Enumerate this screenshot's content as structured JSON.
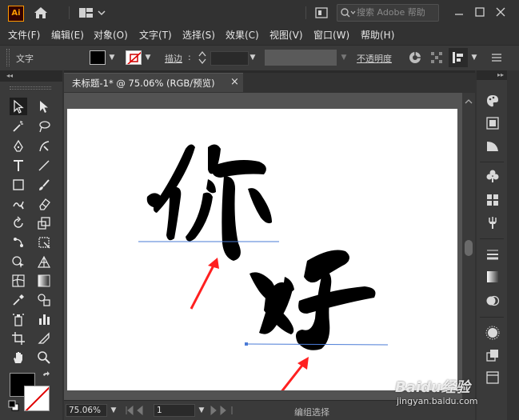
{
  "app": {
    "logo_text": "Ai",
    "search_placeholder": "搜索 Adobe 帮助"
  },
  "menu": [
    "文件(F)",
    "编辑(E)",
    "对象(O)",
    "文字(T)",
    "选择(S)",
    "效果(C)",
    "视图(V)",
    "窗口(W)",
    "帮助(H)"
  ],
  "control": {
    "type_label": "文字",
    "stroke_label": "描边",
    "opacity_label": "不透明度"
  },
  "document": {
    "tab_title": "未标题-1* @ 75.06% (RGB/预览)",
    "close": "×"
  },
  "artwork": {
    "text": "你好"
  },
  "status": {
    "zoom": "75.06%",
    "page": "1",
    "selection": "编组选择"
  },
  "watermark": {
    "brand": "Baidu经验",
    "url": "jingyan.baidu.com"
  },
  "colors": {
    "accent": "#ff9a00",
    "arrow": "#ff2020",
    "guide": "#4a7bd6"
  },
  "tools": [
    "selection",
    "direct-selection",
    "magic-wand",
    "lasso",
    "pen",
    "curvature",
    "type",
    "line",
    "rectangle",
    "paintbrush",
    "shaper",
    "eraser",
    "rotate",
    "scale",
    "puppet-warp",
    "free-transform",
    "shape-builder",
    "perspective",
    "mesh",
    "gradient",
    "eyedropper",
    "blend",
    "symbol-sprayer",
    "column-graph",
    "artboard",
    "slice",
    "hand",
    "zoom"
  ],
  "right_panels": [
    "color-panel",
    "color-guide",
    "gradient-panel",
    "symbols",
    "swatches",
    "brushes",
    "stroke",
    "transparency",
    "appearance",
    "graphic-styles",
    "layers",
    "artboards"
  ]
}
